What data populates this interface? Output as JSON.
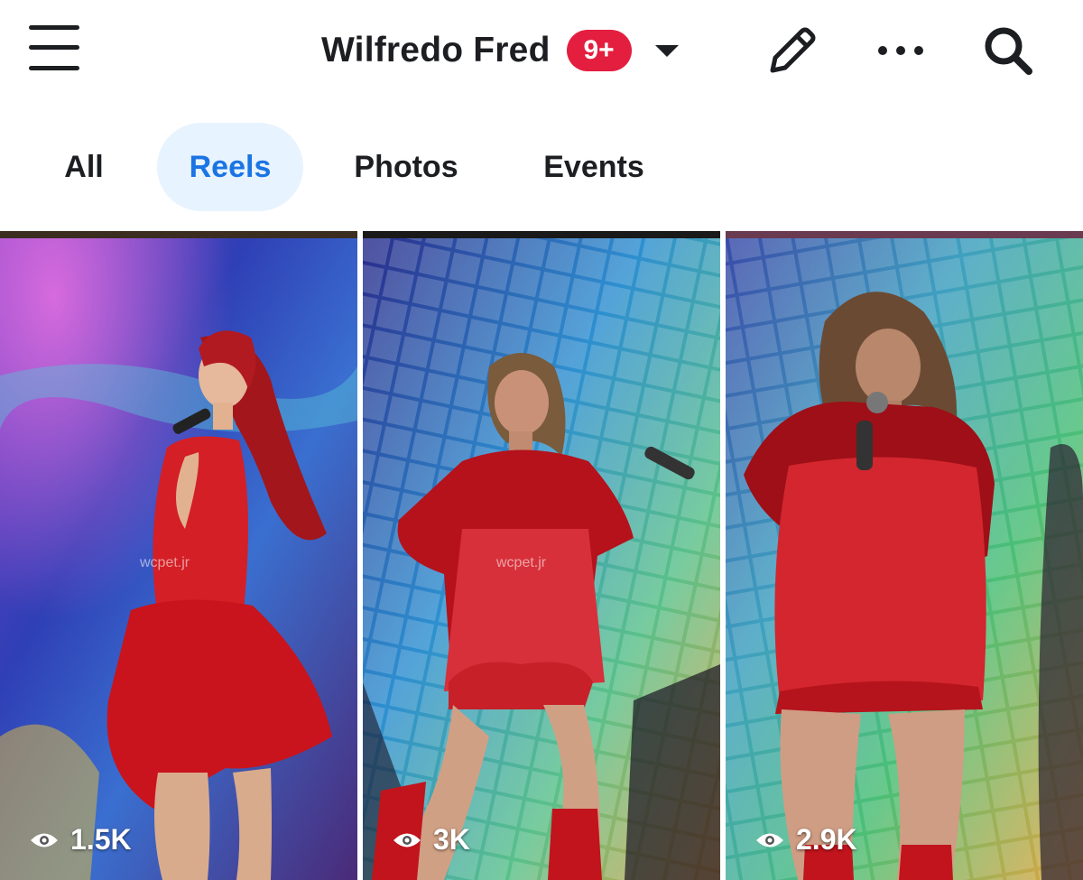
{
  "header": {
    "menu_icon": "hamburger-menu-icon",
    "title": "Wilfredo Fred",
    "notification_badge": "9+",
    "dropdown_icon": "caret-down-icon",
    "edit_icon": "pencil-icon",
    "more_icon": "more-dots-icon",
    "search_icon": "search-icon"
  },
  "tabs": [
    {
      "label": "All",
      "active": false
    },
    {
      "label": "Reels",
      "active": true
    },
    {
      "label": "Photos",
      "active": false
    },
    {
      "label": "Events",
      "active": false
    }
  ],
  "reels": [
    {
      "views": "1.5K",
      "watermark": "wcpet.jr"
    },
    {
      "views": "3K",
      "watermark": "wcpet.jr"
    },
    {
      "views": "2.9K"
    }
  ],
  "colors": {
    "accent": "#1b74e4",
    "active_tab_bg": "#e7f3ff",
    "badge": "#e41e3f",
    "text": "#1c1e21"
  }
}
